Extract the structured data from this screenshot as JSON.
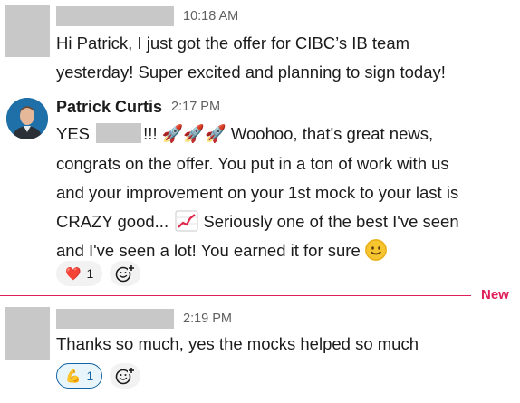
{
  "messages": [
    {
      "time": "10:18 AM",
      "lines": [
        "Hi Patrick, I just got the offer for CIBC’s IB team",
        "yesterday! Super excited and planning to sign today!"
      ]
    },
    {
      "sender": "Patrick Curtis",
      "time": "2:17 PM",
      "line1_a": "YES",
      "line1_b": "!!!",
      "rockets": "🚀🚀🚀",
      "line1_c": "Woohoo, that's great news,",
      "line2": "congrats on the offer.  You put in a ton of work with us",
      "line3": "and your improvement on your 1st mock to your last is",
      "line4_a": "CRAZY good...",
      "line4_b": "Seriously one of the best I've seen",
      "line5": "and I've seen a lot!  You earned it for sure",
      "reaction": {
        "emoji": "❤️",
        "count": "1"
      }
    },
    {
      "time": "2:19 PM",
      "line1": "Thanks so much, yes the mocks helped so much",
      "reaction": {
        "emoji": "💪",
        "count": "1"
      }
    }
  ],
  "divider_label": "New",
  "icons": {
    "avatar": "avatar-photo",
    "chart": "chart-increasing-icon",
    "smile": "slightly-smiling-face-icon",
    "add_reaction": "add-reaction-icon"
  }
}
